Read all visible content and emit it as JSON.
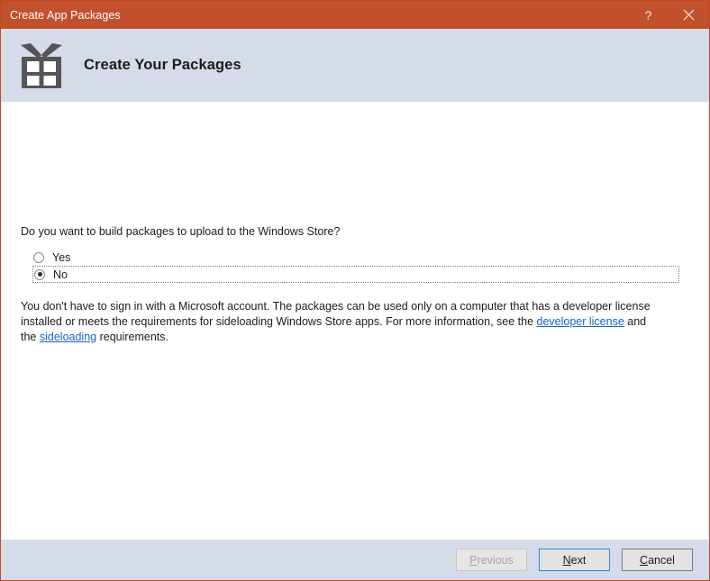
{
  "window": {
    "title": "Create App Packages",
    "accent_color": "#c1512c",
    "header_bg": "#d6dbe9",
    "link_color": "#1464c8"
  },
  "titlebar": {
    "help_glyph": "?",
    "help_name": "help-button",
    "close_name": "close-button"
  },
  "header": {
    "icon": "gift-box-icon",
    "title": "Create Your Packages"
  },
  "content": {
    "question": "Do you want to build packages to upload to the Windows Store?",
    "options": [
      {
        "label": "Yes",
        "selected": false
      },
      {
        "label": "No",
        "selected": true
      }
    ],
    "description": {
      "part1": "You don't have to sign in with a Microsoft account. The packages can be used only on a computer that has a developer license installed or meets the requirements for sideloading Windows Store apps. For more information, see the ",
      "link1": "developer license",
      "part2": " and the ",
      "link2": "sideloading",
      "part3": " requirements."
    }
  },
  "footer": {
    "buttons": [
      {
        "label": "Previous",
        "accel": "P",
        "rest": "revious",
        "state": "disabled"
      },
      {
        "label": "Next",
        "accel": "N",
        "rest": "ext",
        "state": "default"
      },
      {
        "label": "Cancel",
        "accel": "C",
        "rest": "ancel",
        "state": "normal"
      }
    ]
  }
}
